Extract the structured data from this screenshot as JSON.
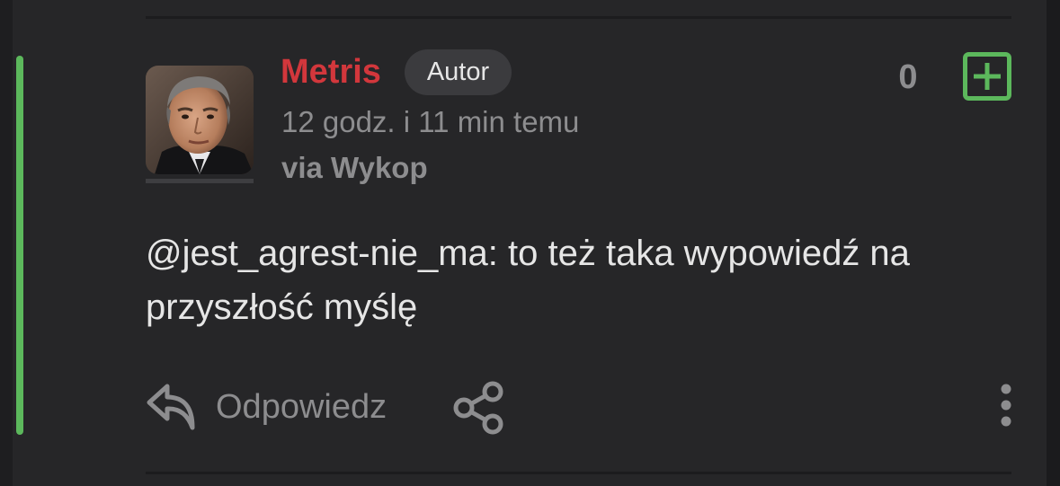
{
  "comment": {
    "author": "Metris",
    "author_badge": "Autor",
    "timestamp": "12 godz. i 11 min temu",
    "via": "via Wykop",
    "vote_count": "0",
    "text": "@jest_agrest-nie_ma: to też taka wypowiedź na przyszłość myślę",
    "actions": {
      "reply_label": "Odpowiedz"
    }
  },
  "icons": {
    "vote": "plus-square-icon",
    "reply": "reply-arrow-icon",
    "share": "share-icon",
    "more": "vertical-ellipsis-icon"
  },
  "colors": {
    "accent": "#5cb85c",
    "author_name": "#d2373c",
    "background": "#262628",
    "muted_text": "#8d8d8f",
    "body_text": "#e6e6e6"
  }
}
